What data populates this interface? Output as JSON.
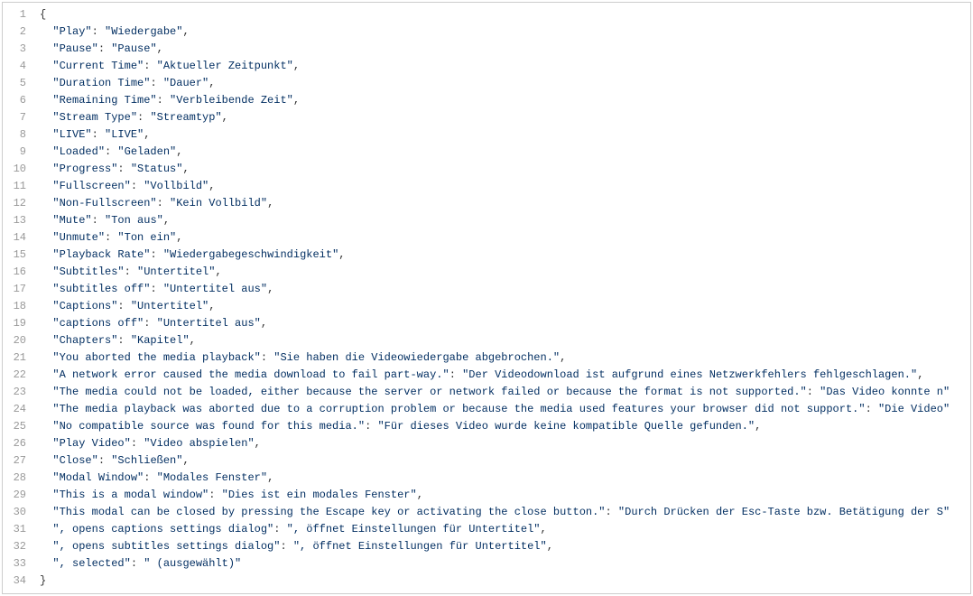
{
  "lines": [
    {
      "num": 1,
      "indent": 0,
      "type": "brace",
      "text": "{"
    },
    {
      "num": 2,
      "indent": 1,
      "type": "kv",
      "key": "Play",
      "value": "Wiedergabe",
      "comma": true
    },
    {
      "num": 3,
      "indent": 1,
      "type": "kv",
      "key": "Pause",
      "value": "Pause",
      "comma": true
    },
    {
      "num": 4,
      "indent": 1,
      "type": "kv",
      "key": "Current Time",
      "value": "Aktueller Zeitpunkt",
      "comma": true
    },
    {
      "num": 5,
      "indent": 1,
      "type": "kv",
      "key": "Duration Time",
      "value": "Dauer",
      "comma": true
    },
    {
      "num": 6,
      "indent": 1,
      "type": "kv",
      "key": "Remaining Time",
      "value": "Verbleibende Zeit",
      "comma": true
    },
    {
      "num": 7,
      "indent": 1,
      "type": "kv",
      "key": "Stream Type",
      "value": "Streamtyp",
      "comma": true
    },
    {
      "num": 8,
      "indent": 1,
      "type": "kv",
      "key": "LIVE",
      "value": "LIVE",
      "comma": true
    },
    {
      "num": 9,
      "indent": 1,
      "type": "kv",
      "key": "Loaded",
      "value": "Geladen",
      "comma": true
    },
    {
      "num": 10,
      "indent": 1,
      "type": "kv",
      "key": "Progress",
      "value": "Status",
      "comma": true
    },
    {
      "num": 11,
      "indent": 1,
      "type": "kv",
      "key": "Fullscreen",
      "value": "Vollbild",
      "comma": true
    },
    {
      "num": 12,
      "indent": 1,
      "type": "kv",
      "key": "Non-Fullscreen",
      "value": "Kein Vollbild",
      "comma": true
    },
    {
      "num": 13,
      "indent": 1,
      "type": "kv",
      "key": "Mute",
      "value": "Ton aus",
      "comma": true
    },
    {
      "num": 14,
      "indent": 1,
      "type": "kv",
      "key": "Unmute",
      "value": "Ton ein",
      "comma": true
    },
    {
      "num": 15,
      "indent": 1,
      "type": "kv",
      "key": "Playback Rate",
      "value": "Wiedergabegeschwindigkeit",
      "comma": true
    },
    {
      "num": 16,
      "indent": 1,
      "type": "kv",
      "key": "Subtitles",
      "value": "Untertitel",
      "comma": true
    },
    {
      "num": 17,
      "indent": 1,
      "type": "kv",
      "key": "subtitles off",
      "value": "Untertitel aus",
      "comma": true
    },
    {
      "num": 18,
      "indent": 1,
      "type": "kv",
      "key": "Captions",
      "value": "Untertitel",
      "comma": true
    },
    {
      "num": 19,
      "indent": 1,
      "type": "kv",
      "key": "captions off",
      "value": "Untertitel aus",
      "comma": true
    },
    {
      "num": 20,
      "indent": 1,
      "type": "kv",
      "key": "Chapters",
      "value": "Kapitel",
      "comma": true
    },
    {
      "num": 21,
      "indent": 1,
      "type": "kv",
      "key": "You aborted the media playback",
      "value": "Sie haben die Videowiedergabe abgebrochen.",
      "comma": true
    },
    {
      "num": 22,
      "indent": 1,
      "type": "kv",
      "key": "A network error caused the media download to fail part-way.",
      "value": "Der Videodownload ist aufgrund eines Netzwerkfehlers fehlgeschlagen.",
      "comma": true
    },
    {
      "num": 23,
      "indent": 1,
      "type": "kv",
      "key": "The media could not be loaded, either because the server or network failed or because the format is not supported.",
      "value": "Das Video konnte n",
      "comma": false
    },
    {
      "num": 24,
      "indent": 1,
      "type": "kv",
      "key": "The media playback was aborted due to a corruption problem or because the media used features your browser did not support.",
      "value": "Die Video",
      "comma": false
    },
    {
      "num": 25,
      "indent": 1,
      "type": "kv",
      "key": "No compatible source was found for this media.",
      "value": "Für dieses Video wurde keine kompatible Quelle gefunden.",
      "comma": true
    },
    {
      "num": 26,
      "indent": 1,
      "type": "kv",
      "key": "Play Video",
      "value": "Video abspielen",
      "comma": true
    },
    {
      "num": 27,
      "indent": 1,
      "type": "kv",
      "key": "Close",
      "value": "Schließen",
      "comma": true
    },
    {
      "num": 28,
      "indent": 1,
      "type": "kv",
      "key": "Modal Window",
      "value": "Modales Fenster",
      "comma": true
    },
    {
      "num": 29,
      "indent": 1,
      "type": "kv",
      "key": "This is a modal window",
      "value": "Dies ist ein modales Fenster",
      "comma": true
    },
    {
      "num": 30,
      "indent": 1,
      "type": "kv",
      "key": "This modal can be closed by pressing the Escape key or activating the close button.",
      "value": "Durch Drücken der Esc-Taste bzw. Betätigung der S",
      "comma": false
    },
    {
      "num": 31,
      "indent": 1,
      "type": "kv",
      "key": ", opens captions settings dialog",
      "value": ", öffnet Einstellungen für Untertitel",
      "comma": true
    },
    {
      "num": 32,
      "indent": 1,
      "type": "kv",
      "key": ", opens subtitles settings dialog",
      "value": ", öffnet Einstellungen für Untertitel",
      "comma": true
    },
    {
      "num": 33,
      "indent": 1,
      "type": "kv",
      "key": ", selected",
      "value": " (ausgewählt)",
      "comma": false
    },
    {
      "num": 34,
      "indent": 0,
      "type": "brace",
      "text": "}"
    }
  ]
}
